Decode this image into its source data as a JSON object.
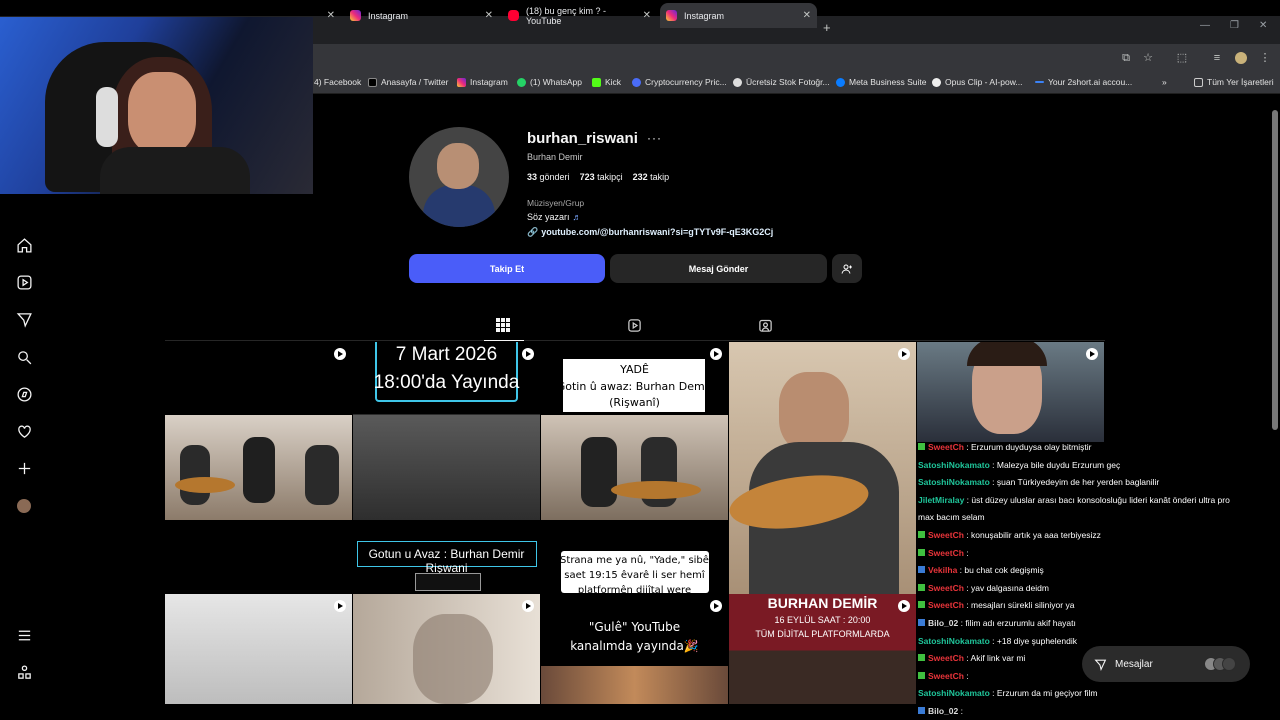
{
  "browser": {
    "tabs": [
      {
        "title": "",
        "icon": "instagram-icon"
      },
      {
        "title": "Instagram",
        "icon": "instagram-icon"
      },
      {
        "title": "(18) bu genç kim ? - YouTube",
        "icon": "youtube-icon"
      },
      {
        "title": "Instagram",
        "icon": "instagram-icon"
      }
    ],
    "bookmarks": [
      "4) Facebook",
      "Anasayfa / Twitter",
      "Instagram",
      "(1) WhatsApp",
      "Kick",
      "Cryptocurrency Pric...",
      "Ücretsiz Stok Fotoğr...",
      "Meta Business Suite",
      "Opus Clip - AI-pow...",
      "Your 2short.ai accou...",
      "Tüm Yer İşaretleri"
    ]
  },
  "profile": {
    "username": "burhan_riswani",
    "full_name": "Burhan Demir",
    "posts_count": "33",
    "posts_label": "gönderi",
    "followers_count": "723",
    "followers_label": "takipçi",
    "following_count": "232",
    "following_label": "takip",
    "category": "Müzisyen/Grup",
    "bio": "Söz yazarı",
    "bio_emoji": "♬",
    "link": "youtube.com/@burhanriswani?si=gTYTv9F-qE3KG2Cj",
    "follow_button": "Takip Et",
    "message_button": "Mesaj Gönder"
  },
  "grid_texts": {
    "date_line1": "7 Mart 2026",
    "date_line2": "18:00'da Yayında",
    "yade_title": "YADÊ",
    "yade_line1": "Gotin û awaz: Burhan Demir",
    "yade_line2": "(Rişwanî)",
    "gotun": "Gotun u Avaz : Burhan Demir Rişwani",
    "strana_line1": "Strana me ya nû, \"Yade,\" sibê",
    "strana_line2": "saet 19:15 êvarê li ser hemî",
    "strana_line3": "platformên dijîtal were",
    "gule_line1": "\"Gulê\" YouTube",
    "gule_line2": "kanalımda yayında🎉",
    "banner_name": "BURHAN DEMİR",
    "banner_date": "16 EYLÜL SAAT : 20:00",
    "banner_platforms": "TÜM DİJİTAL PLATFORMLARDA"
  },
  "chat": [
    {
      "user": "SweetCh",
      "text": ": Erzurum duyduysa olay bitmiştir",
      "color": "#e8343a",
      "badge": "#40c040"
    },
    {
      "user": "SatoshiNokamato",
      "text": ": Malezya bile duydu Erzurum geç",
      "color": "#1fc59a",
      "badge": ""
    },
    {
      "user": "SatoshiNokamato",
      "text": ": şuan Türkiyedeyim de her yerden baglanilir",
      "color": "#1fc59a",
      "badge": ""
    },
    {
      "user": "JiletMiralay",
      "text": ": üst düzey uluslar arası bacı konsolosluğu lideri kanât önderi ultra pro",
      "color": "#1fc59a",
      "badge": ""
    },
    {
      "user": "",
      "text": "max bacım selam",
      "color": "#fff",
      "badge": ""
    },
    {
      "user": "SweetCh",
      "text": ": konuşabilir artık ya aaa terbiyesizz",
      "color": "#e8343a",
      "badge": "#40c040"
    },
    {
      "user": "SweetCh",
      "text": ": ",
      "color": "#e8343a",
      "badge": "#40c040"
    },
    {
      "user": "Vekilha",
      "text": ": bu chat cok degişmiş",
      "color": "#e8343a",
      "badge": "#3a7bd5"
    },
    {
      "user": "SweetCh",
      "text": ": yav dalgasına deidm",
      "color": "#e8343a",
      "badge": "#40c040"
    },
    {
      "user": "SweetCh",
      "text": ": mesajları sürekli siliniyor ya",
      "color": "#e8343a",
      "badge": "#40c040"
    },
    {
      "user": "Bilo_02",
      "text": ": filim adı erzurumlu akif hayatı",
      "color": "#dddddd",
      "badge": "#3a7bd5"
    },
    {
      "user": "SatoshiNokamato",
      "text": ": +18 diye şuphelendik",
      "color": "#1fc59a",
      "badge": ""
    },
    {
      "user": "SweetCh",
      "text": ": Akif link var mi",
      "color": "#e8343a",
      "badge": "#40c040"
    },
    {
      "user": "SweetCh",
      "text": ": ",
      "color": "#e8343a",
      "badge": "#40c040"
    },
    {
      "user": "SatoshiNokamato",
      "text": ": Erzurum da mi geçiyor film",
      "color": "#1fc59a",
      "badge": ""
    },
    {
      "user": "Bilo_02",
      "text": ": ",
      "color": "#dddddd",
      "badge": "#3a7bd5"
    }
  ],
  "messages_pill": "Mesajlar"
}
